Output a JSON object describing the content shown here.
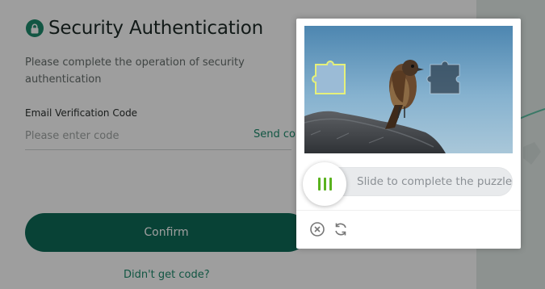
{
  "page": {
    "title": "Security Authentication",
    "description": "Please complete the operation of security authentication",
    "code_label": "Email Verification Code",
    "code_placeholder": "Please enter code",
    "send_code": "Send co",
    "confirm": "Confirm",
    "no_code": "Didn't get code?"
  },
  "captcha": {
    "slider_hint": "Slide to complete the puzzle",
    "icons": {
      "handle": "drag-handle-icon",
      "close": "close-circle-icon",
      "refresh": "refresh-icon"
    }
  },
  "colors": {
    "brand": "#0e6b58",
    "accent": "#1d8b6d",
    "slider_handle": "#5ab21e"
  }
}
